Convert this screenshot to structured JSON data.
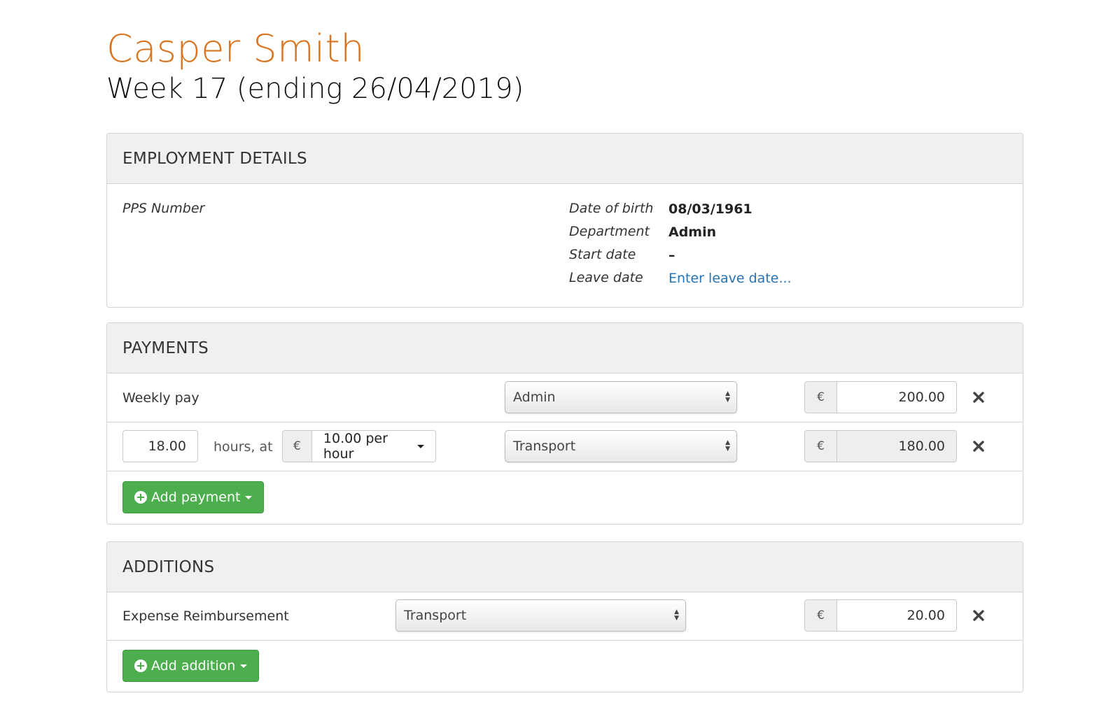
{
  "header": {
    "employee_name": "Casper Smith",
    "week_title": "Week 17 (ending 26/04/2019)"
  },
  "employment": {
    "heading": "EMPLOYMENT DETAILS",
    "pps_label": "PPS Number",
    "dob_label": "Date of birth",
    "dob_value": "08/03/1961",
    "department_label": "Department",
    "department_value": "Admin",
    "start_label": "Start date",
    "start_value": "–",
    "leave_label": "Leave date",
    "leave_link": "Enter leave date..."
  },
  "payments": {
    "heading": "PAYMENTS",
    "rows": [
      {
        "label": "Weekly pay",
        "department": "Admin",
        "currency": "€",
        "amount": "200.00"
      },
      {
        "hours": "18.00",
        "hours_text": "hours, at",
        "rate_currency": "€",
        "rate": "10.00 per hour",
        "department": "Transport",
        "currency": "€",
        "amount": "180.00"
      }
    ],
    "add_button": "Add payment"
  },
  "additions": {
    "heading": "ADDITIONS",
    "rows": [
      {
        "label": "Expense Reimbursement",
        "department": "Transport",
        "currency": "€",
        "amount": "20.00"
      }
    ],
    "add_button": "Add addition"
  },
  "icons": {
    "remove": "close-icon",
    "select_arrows": "updown-icon",
    "add": "plus-circle-icon"
  },
  "colors": {
    "name": "#d9741f",
    "link": "#2574b6",
    "success": "#4cae4c"
  }
}
